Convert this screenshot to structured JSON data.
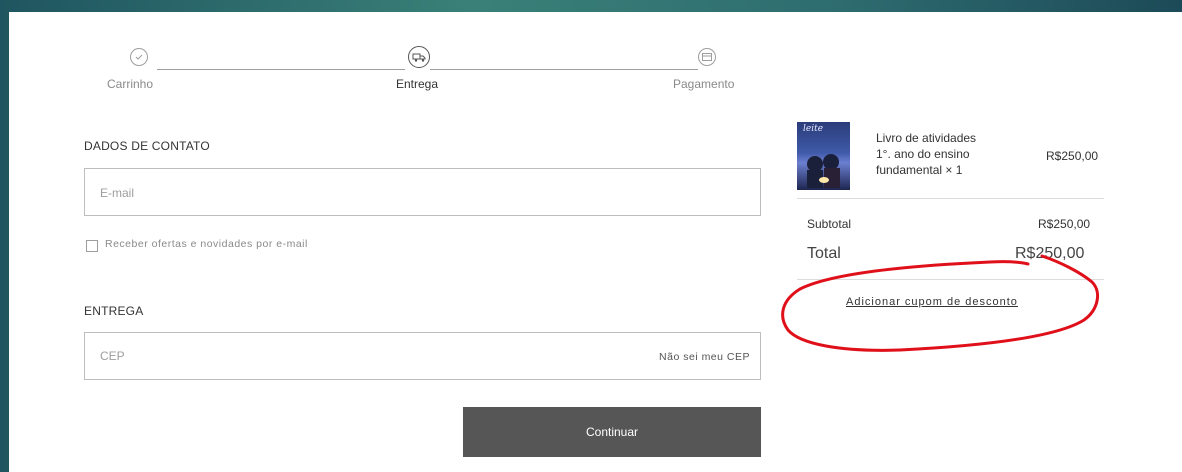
{
  "stepper": {
    "steps": [
      {
        "label": "Carrinho",
        "state": "done"
      },
      {
        "label": "Entrega",
        "state": "active"
      },
      {
        "label": "Pagamento",
        "state": "pending"
      }
    ]
  },
  "contact": {
    "title": "DADOS DE CONTATO",
    "email_placeholder": "E-mail",
    "newsletter_label": "Receber ofertas e novidades por e-mail"
  },
  "delivery": {
    "title": "ENTREGA",
    "cep_placeholder": "CEP",
    "cep_help_link": "Não sei meu CEP",
    "continue_label": "Continuar"
  },
  "summary": {
    "item": {
      "name_lines": [
        "Livro de atividades",
        "1°. ano do ensino",
        "fundamental × 1"
      ],
      "price": "R$250,00",
      "thumb_text": "leite"
    },
    "subtotal_label": "Subtotal",
    "subtotal_value": "R$250,00",
    "total_label": "Total",
    "total_value": "R$250,00",
    "coupon_link": "Adicionar cupom de desconto"
  },
  "colors": {
    "annotation": "#e0101a",
    "button_bg": "#565656"
  }
}
